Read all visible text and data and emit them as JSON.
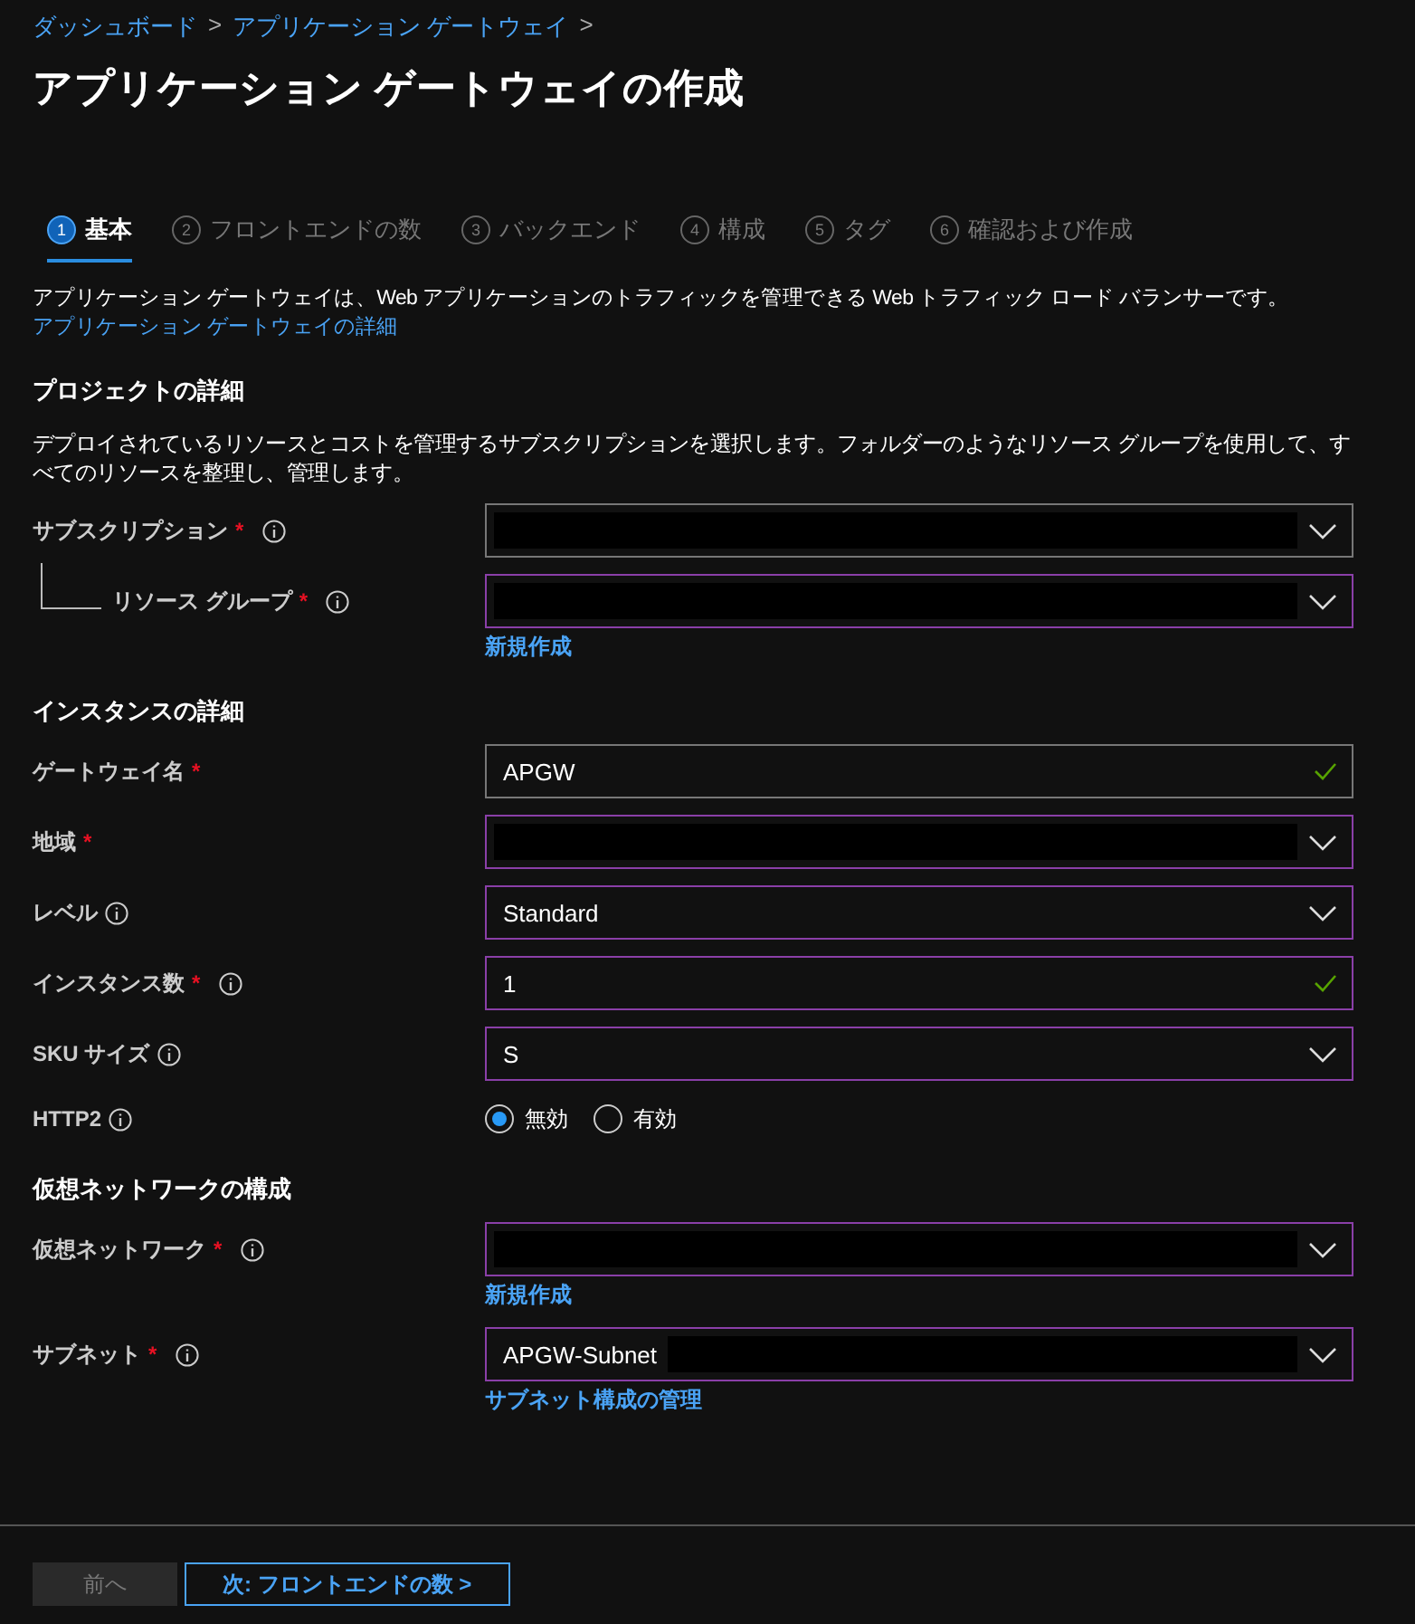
{
  "breadcrumb": [
    {
      "label": "ダッシュボード",
      "separator": ">"
    },
    {
      "label": "アプリケーション ゲートウェイ",
      "separator": ">"
    }
  ],
  "title": "アプリケーション ゲートウェイの作成",
  "tabs": [
    {
      "number": "1",
      "label": "基本",
      "selected": true
    },
    {
      "number": "2",
      "label": "フロントエンドの数",
      "selected": false
    },
    {
      "number": "3",
      "label": "バックエンド",
      "selected": false
    },
    {
      "number": "4",
      "label": "構成",
      "selected": false
    },
    {
      "number": "5",
      "label": "タグ",
      "selected": false
    },
    {
      "number": "6",
      "label": "確認および作成",
      "selected": false
    }
  ],
  "intro": {
    "text": "アプリケーション ゲートウェイは、Web アプリケーションのトラフィックを管理できる Web トラフィック ロード バランサーです。",
    "link": "アプリケーション ゲートウェイの詳細"
  },
  "sections": [
    {
      "heading": "プロジェクトの詳細",
      "description": "デプロイされているリソースとコストを管理するサブスクリプションを選択します。フォルダーのようなリソース グループを使用して、すべてのリソースを整理し、管理します。",
      "fields": [
        {
          "kind": "select",
          "label": "サブスクリプション",
          "required_mark": "*",
          "info": true,
          "redacted": true,
          "highlighted": false,
          "valid": false,
          "children": [
            {
              "kind": "select",
              "label": "リソース グループ",
              "required_mark": "*",
              "info": true,
              "redacted": true,
              "highlighted": true,
              "valid": false,
              "link": "新規作成"
            }
          ]
        }
      ]
    },
    {
      "heading": "インスタンスの詳細",
      "fields": [
        {
          "kind": "text",
          "label": "ゲートウェイ名",
          "required_mark": "*",
          "info": false,
          "value": "APGW",
          "redacted": false,
          "highlighted": false,
          "valid": true
        },
        {
          "kind": "select",
          "label": "地域",
          "required_mark": "*",
          "info": false,
          "redacted": true,
          "highlighted": true,
          "valid": false
        },
        {
          "kind": "select",
          "label": "レベル",
          "info": true,
          "value": "Standard",
          "redacted": false,
          "highlighted": true,
          "valid": false
        },
        {
          "kind": "text",
          "label": "インスタンス数",
          "required_mark": "*",
          "info": true,
          "value": "1",
          "redacted": false,
          "highlighted": true,
          "valid": true
        },
        {
          "kind": "select",
          "label": "SKU サイズ",
          "info": true,
          "value": "S",
          "redacted": false,
          "highlighted": true,
          "valid": false
        },
        {
          "kind": "radio",
          "label": "HTTP2",
          "info": true,
          "options": [
            {
              "label": "無効",
              "selected": true
            },
            {
              "label": "有効",
              "selected": false
            }
          ]
        }
      ]
    },
    {
      "heading": "仮想ネットワークの構成",
      "fields": [
        {
          "kind": "select",
          "label": "仮想ネットワーク",
          "required_mark": "*",
          "info": true,
          "redacted": true,
          "highlighted": true,
          "valid": false,
          "link": "新規作成"
        },
        {
          "kind": "select",
          "label": "サブネット",
          "required_mark": "*",
          "info": true,
          "value": "APGW-Subnet",
          "redacted": true,
          "highlighted": true,
          "valid": false,
          "link": "サブネット構成の管理"
        }
      ]
    }
  ],
  "footer": {
    "previous": {
      "label": "前へ",
      "disabled": true
    },
    "next": {
      "label": "次: フロントエンドの数 >",
      "disabled": false
    }
  }
}
